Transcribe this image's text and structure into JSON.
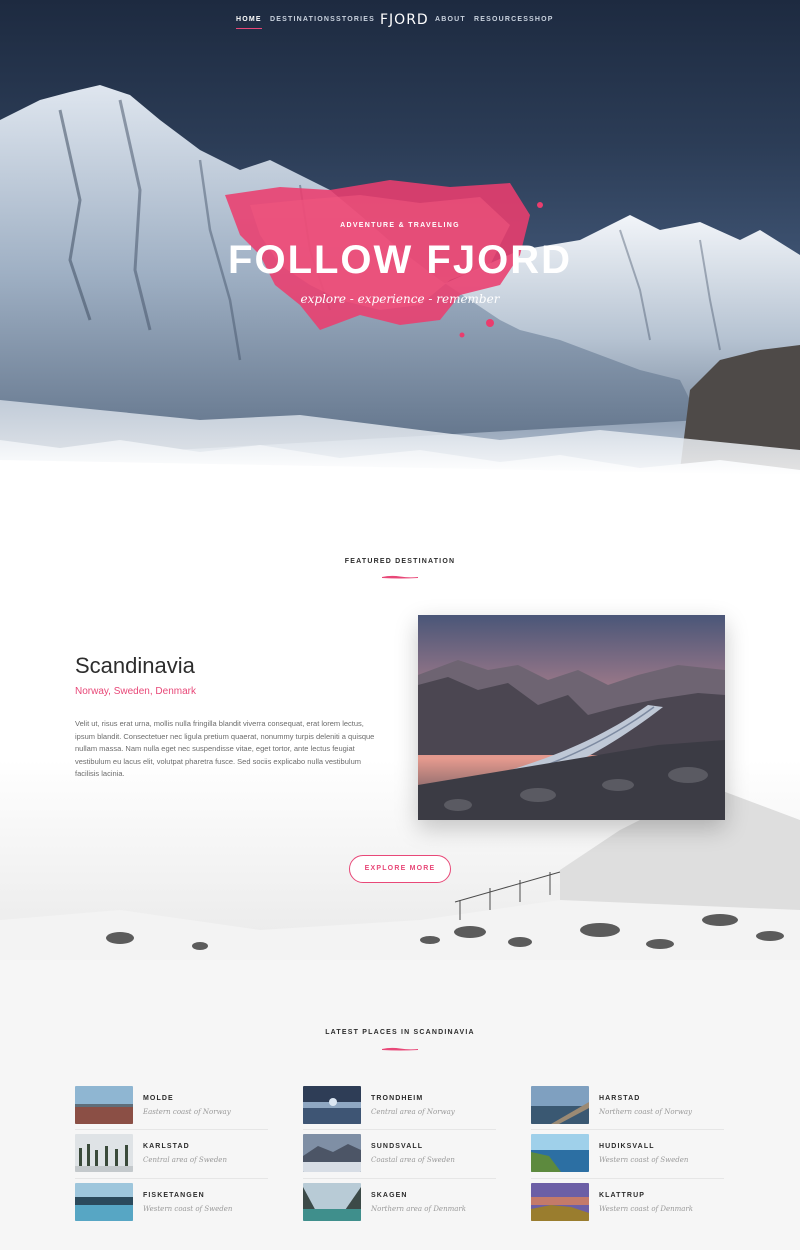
{
  "nav": {
    "left": [
      "HOME",
      "DESTINATIONS",
      "STORIES"
    ],
    "logo": "FJORD",
    "right": [
      "ABOUT",
      "RESOURCES",
      "SHOP"
    ],
    "active": "HOME"
  },
  "hero": {
    "eyebrow": "ADVENTURE & TRAVELING",
    "title": "FOLLOW FJORD",
    "subtitle": "explore - experience - remember"
  },
  "featured": {
    "label": "FEATURED DESTINATION",
    "title": "Scandinavia",
    "subtitle": "Norway, Sweden, Denmark",
    "body": "Velit ut, risus erat urna, mollis nulla fringilla blandit viverra consequat, erat lorem lectus, ipsum blandit. Consectetuer nec ligula pretium quaerat, nonummy turpis deleniti a quisque nullam massa. Nam nulla eget nec suspendisse vitae, eget tortor, ante lectus feugiat vestibulum eu lacus elit, volutpat pharetra fusce. Sed sociis explicabo nulla vestibulum facilisis lacinia.",
    "button": "EXPLORE MORE"
  },
  "latest": {
    "label": "LATEST PLACES IN SCANDINAVIA",
    "places": [
      {
        "name": "MOLDE",
        "area": "Eastern coast of Norway"
      },
      {
        "name": "TRONDHEIM",
        "area": "Central area of Norway"
      },
      {
        "name": "HARSTAD",
        "area": "Northern coast of Norway"
      },
      {
        "name": "KARLSTAD",
        "area": "Central area of Sweden"
      },
      {
        "name": "SUNDSVALL",
        "area": "Coastal area of Sweden"
      },
      {
        "name": "HUDIKSVALL",
        "area": "Western coast of Sweden"
      },
      {
        "name": "FISKETANGEN",
        "area": "Western coast of Sweden"
      },
      {
        "name": "SKAGEN",
        "area": "Northern area of Denmark"
      },
      {
        "name": "KLATTRUP",
        "area": "Western coast of Denmark"
      }
    ]
  },
  "colors": {
    "accent": "#e84878",
    "text": "#2b2b2b",
    "muted": "#9a9a9a"
  }
}
